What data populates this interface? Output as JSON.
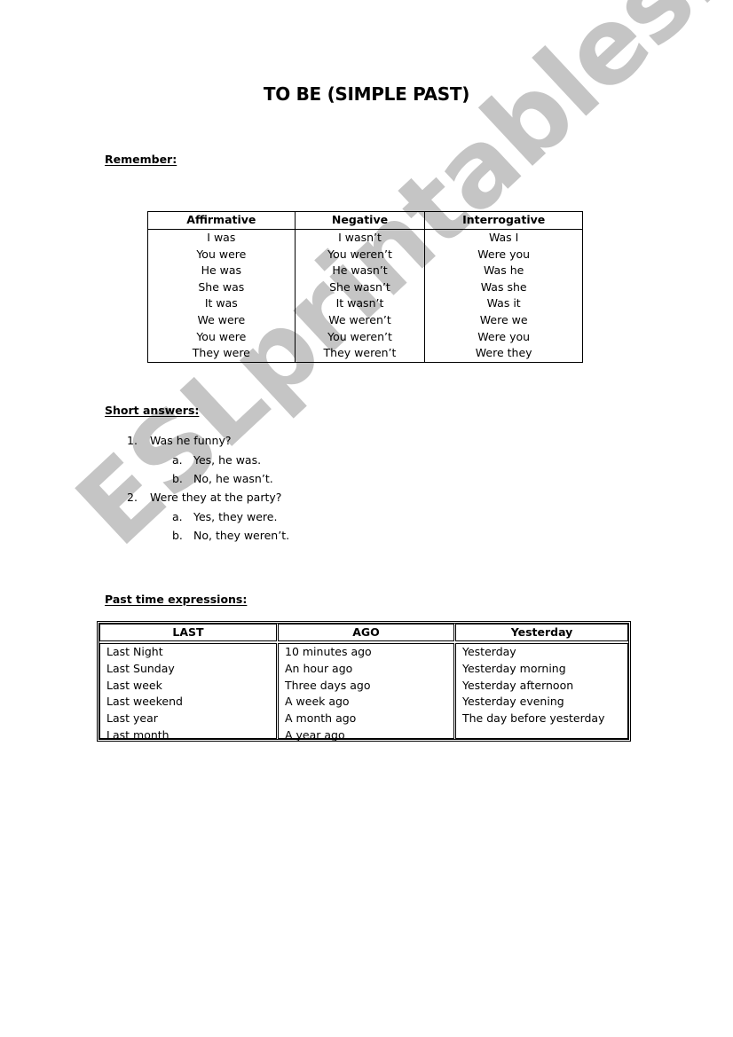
{
  "title": "TO BE (SIMPLE PAST)",
  "remember": {
    "heading": "Remember:",
    "table": {
      "headers": [
        "Affirmative",
        "Negative",
        "Interrogative"
      ],
      "rows": [
        [
          "I was",
          "I wasn’t",
          "Was I"
        ],
        [
          "You were",
          "You weren’t",
          "Were you"
        ],
        [
          "He was",
          "He wasn’t",
          "Was he"
        ],
        [
          "She was",
          "She wasn’t",
          "Was she"
        ],
        [
          "It was",
          "It wasn’t",
          "Was it"
        ],
        [
          "We were",
          "We weren’t",
          "Were we"
        ],
        [
          "You were",
          "You weren’t",
          "Were you"
        ],
        [
          "They were",
          "They weren’t",
          "Were they"
        ]
      ]
    }
  },
  "short_answers": {
    "heading": "Short answers:",
    "items": [
      {
        "number": "1.",
        "question": "Was he funny?",
        "answers": [
          {
            "letter": "a.",
            "text": "Yes, he was."
          },
          {
            "letter": "b.",
            "text": "No, he wasn’t."
          }
        ]
      },
      {
        "number": "2.",
        "question": "Were they at the party?",
        "answers": [
          {
            "letter": "a.",
            "text": "Yes, they were."
          },
          {
            "letter": "b.",
            "text": "No, they weren’t."
          }
        ]
      }
    ]
  },
  "past_time": {
    "heading": "Past time expressions:",
    "columns": [
      {
        "header": "LAST",
        "items": [
          "Last Night",
          "Last Sunday",
          "Last week",
          "Last weekend",
          "Last year",
          "Last month"
        ]
      },
      {
        "header": "AGO",
        "items": [
          "10 minutes ago",
          "An hour ago",
          "Three days ago",
          "A week ago",
          "A month ago",
          "A year ago"
        ]
      },
      {
        "header": "Yesterday",
        "items": [
          "Yesterday",
          "Yesterday morning",
          "Yesterday afternoon",
          "Yesterday evening",
          "The day before yesterday"
        ]
      }
    ]
  },
  "watermark": "ESLprintables.com"
}
